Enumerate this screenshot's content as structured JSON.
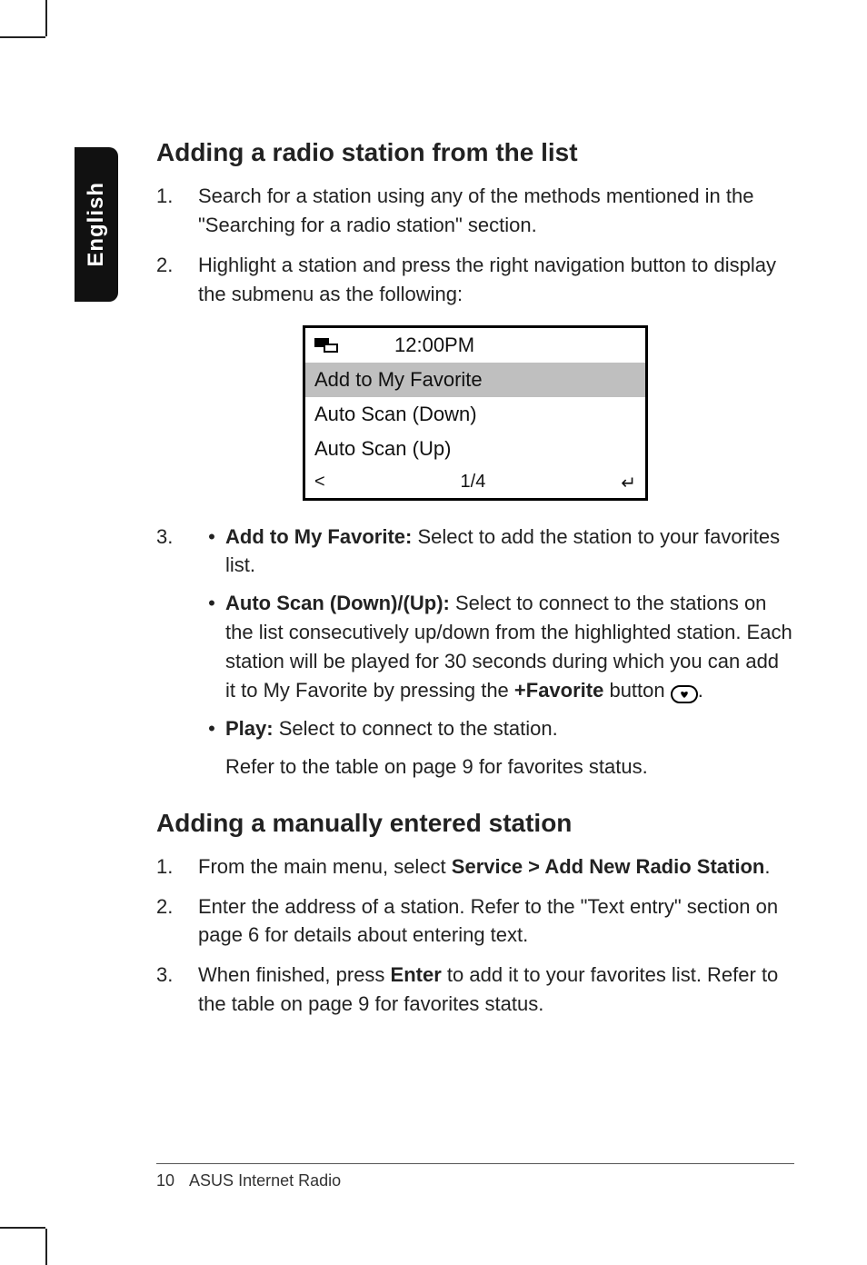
{
  "sidetab": {
    "label": "English"
  },
  "section1": {
    "heading": "Adding a radio station from the list",
    "steps": [
      {
        "num": "1.",
        "text_a": "Search for a station using any of the methods mentioned in the \"Searching for a radio station\" section."
      },
      {
        "num": "2.",
        "text_a": "Highlight a station and press the right navigation button to display the submenu as the following:"
      }
    ],
    "screen": {
      "time": "12:00PM",
      "row_selected": "Add to My Favorite",
      "row2": "Auto Scan (Down)",
      "row3": "Auto Scan (Up)",
      "foot_left": "<",
      "foot_mid": "1/4",
      "foot_right": "↵"
    },
    "step3_num": "3.",
    "bullets": [
      {
        "bold": "Add to My Favorite:",
        "rest": " Select to add the station to your favorites list."
      },
      {
        "bold": "Auto Scan (Down)/(Up):",
        "rest_a": " Select to connect to the stations on the list consecutively up/down from the highlighted station. Each station will be played for 30 seconds during which you can add it to My Favorite by pressing the ",
        "fav_label": "+Favorite",
        "rest_b": " button ",
        "rest_c": "."
      },
      {
        "bold": "Play:",
        "rest": " Select to connect to the station."
      }
    ],
    "after_bullets": "Refer to the table on page 9 for favorites status."
  },
  "section2": {
    "heading": "Adding a manually entered station",
    "steps": [
      {
        "num": "1.",
        "pre": "From the main menu, select ",
        "bold": "Service > Add New Radio Station",
        "post": "."
      },
      {
        "num": "2.",
        "text": "Enter the address of a station. Refer to the \"Text entry\" section on page 6 for details about entering text."
      },
      {
        "num": "3.",
        "pre": "When finished, press ",
        "bold": "Enter",
        "post": " to add it to your favorites list. Refer to the table on page 9 for favorites status."
      }
    ]
  },
  "footer": {
    "page": "10",
    "title": "ASUS Internet Radio"
  }
}
